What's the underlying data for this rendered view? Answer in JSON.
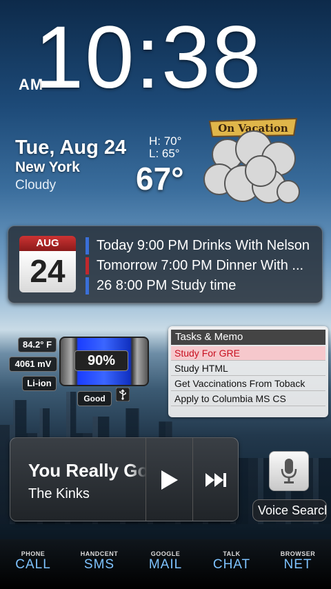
{
  "clock": {
    "ampm": "AM",
    "time": "10:38"
  },
  "weather": {
    "date": "Tue, Aug 24",
    "city": "New York",
    "condition": "Cloudy",
    "high": "H: 70°",
    "low": "L: 65°",
    "current": "67°",
    "sign": "On Vacation"
  },
  "calendar": {
    "month": "AUG",
    "day": "24",
    "events": [
      {
        "text": "Today 9:00 PM Drinks With Nelson",
        "color": "#3a6fd8"
      },
      {
        "text": "Tomorrow 7:00 PM Dinner With ...",
        "color": "#c0282d"
      },
      {
        "text": "26 8:00 PM Study time",
        "color": "#3a6fd8"
      }
    ]
  },
  "battery": {
    "temp": "84.2° F",
    "voltage": "4061 mV",
    "type": "Li-ion",
    "percent": "90%",
    "level": 0.9,
    "health": "Good"
  },
  "tasks": {
    "title": "Tasks & Memo",
    "items": [
      "Study For GRE",
      "Study HTML",
      "Get Vaccinations From Toback",
      "Apply to Columbia MS CS"
    ]
  },
  "music": {
    "song": "You Really Got Me",
    "artist": "The Kinks"
  },
  "voice": {
    "label": "Voice Search"
  },
  "dock": [
    {
      "caption": "PHONE",
      "label": "CALL"
    },
    {
      "caption": "HANDCENT",
      "label": "SMS"
    },
    {
      "caption": "GOOGLE",
      "label": "MAIL"
    },
    {
      "caption": "TALK",
      "label": "CHAT"
    },
    {
      "caption": "BROWSER",
      "label": "NET"
    }
  ]
}
